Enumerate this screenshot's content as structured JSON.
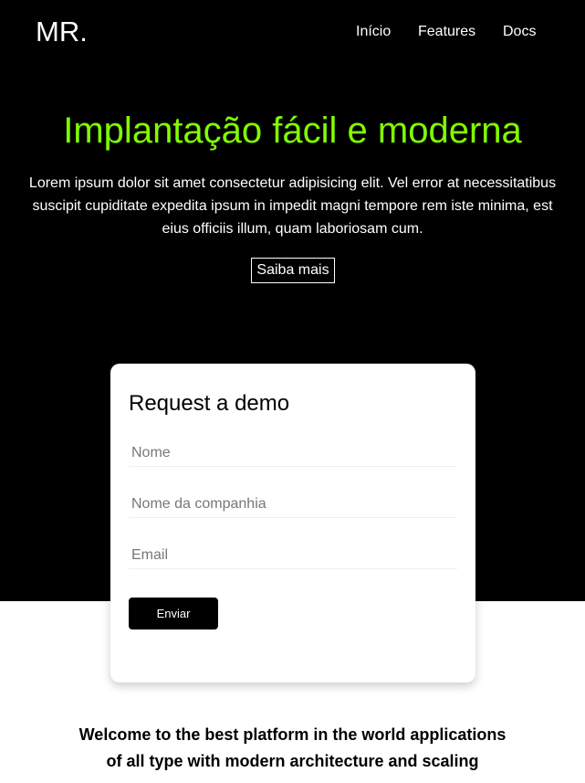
{
  "header": {
    "logo": "MR.",
    "nav": [
      "Início",
      "Features",
      "Docs"
    ]
  },
  "hero": {
    "title": "Implantação fácil e moderna",
    "lead": "Lorem ipsum dolor sit amet consectetur adipisicing elit. Vel error at necessitatibus suscipit cupiditate expedita ipsum in impedit magni tempore rem iste minima, est eius officiis illum, quam laboriosam cum.",
    "button": "Saiba mais"
  },
  "form": {
    "title": "Request a demo",
    "name_placeholder": "Nome",
    "company_placeholder": "Nome da companhia",
    "email_placeholder": "Email",
    "submit": "Enviar"
  },
  "welcome": {
    "line1": "Welcome to the best platform in the world applications",
    "line2": "of all type with modern architecture and scaling"
  },
  "colors": {
    "accent": "#7fff00",
    "hero_bg": "#000000"
  }
}
